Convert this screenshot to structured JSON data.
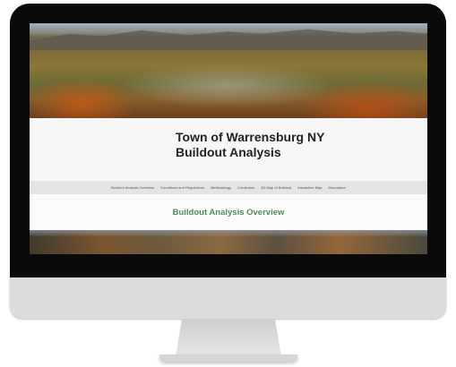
{
  "site": {
    "title_line1": "Town of Warrensburg NY",
    "title_line2": "Buildout Analysis"
  },
  "nav": {
    "items": [
      {
        "label": "Buildout Analysis Overview"
      },
      {
        "label": "Conditions and Regulations"
      },
      {
        "label": "Methodology"
      },
      {
        "label": "Constrains"
      },
      {
        "label": "3D Map of Buildout"
      },
      {
        "label": "Interactive Map"
      },
      {
        "label": "Discussion"
      }
    ]
  },
  "main": {
    "heading": "Buildout Analysis Overview"
  },
  "colors": {
    "heading_green": "#4f8a5e",
    "nav_bar": "#e4e4e4",
    "bezel": "#0a0a0a"
  }
}
